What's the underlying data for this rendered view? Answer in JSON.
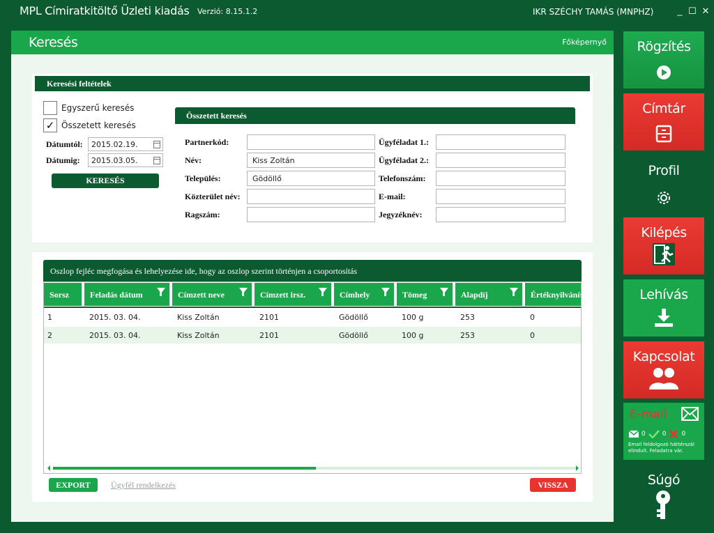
{
  "window": {
    "app_title": "MPL Címiratkitöltő Üzleti kiadás",
    "version": "Verzió: 8.15.1.2",
    "user": "IKR SZÉCHY TAMÁS (MNPHZ)",
    "minimize": "_",
    "maximize": "☐",
    "close": "✕"
  },
  "page": {
    "title": "Keresés",
    "home_link": "Főképernyő"
  },
  "criteria": {
    "heading": "Keresési feltételek",
    "simple_search_label": "Egyszerű keresés",
    "simple_search_checked": "",
    "composite_search_label": "Összetett keresés",
    "composite_search_checked": "✓",
    "date_from_label": "Dátumtól:",
    "date_from_value": "2015.02.19.",
    "date_to_label": "Dátumig:",
    "date_to_value": "2015.03.05.",
    "search_button": "KERESÉS"
  },
  "composite": {
    "heading": "Összetett keresés",
    "fields": {
      "partner_code_label": "Partnerkód:",
      "partner_code_value": "",
      "name_label": "Név:",
      "name_value": "Kiss Zoltán",
      "city_label": "Település:",
      "city_value": "Gödöllő",
      "street_label": "Közterület név:",
      "street_value": "",
      "tag_label": "Ragszám:",
      "tag_value": "",
      "client_data1_label": "Ügyféladat 1.:",
      "client_data1_value": "",
      "client_data2_label": "Ügyféladat 2.:",
      "client_data2_value": "",
      "phone_label": "Telefonszám:",
      "phone_value": "",
      "email_label": "E-mail:",
      "email_value": "",
      "register_label": "Jegyzéknév:",
      "register_value": ""
    }
  },
  "results": {
    "group_hint": "Oszlop fejléc megfogása és lehelyezése ide, hogy az oszlop szerint történjen a csoportosítás",
    "columns": [
      "Sorsz",
      "Feladás dátum",
      "Címzett neve",
      "Címzett irsz.",
      "Címhely",
      "Tömeg",
      "Alapdíj",
      "Értéknyilvánítás"
    ],
    "rows": [
      [
        "1",
        "2015. 03. 04.",
        "Kiss Zoltán",
        "2101",
        "Gödöllő",
        "100 g",
        "253",
        "0"
      ],
      [
        "2",
        "2015. 03. 04.",
        "Kiss Zoltán",
        "2101",
        "Gödöllő",
        "100 g",
        "253",
        "0"
      ]
    ],
    "scroll_position": 0.5,
    "export_button": "EXPORT",
    "client_link": "Ügyfél rendelkezés",
    "back_button": "VISSZA"
  },
  "tiles": {
    "record": "Rögzítés",
    "directory": "Címtár",
    "profile": "Profil",
    "exit": "Kilépés",
    "download": "Lehívás",
    "contact": "Kapcsolat",
    "help": "Súgó"
  },
  "email": {
    "label": "E-mail",
    "sent_count": "0",
    "ok_count": "0",
    "error_count": "0",
    "note": "Email feldolgozó háttérszál elindult. Feladatra vár."
  },
  "colors": {
    "dark_green": "#0c5a2f",
    "green": "#1aa64b",
    "red": "#e8332e",
    "panel_bg": "#eef7ef"
  }
}
